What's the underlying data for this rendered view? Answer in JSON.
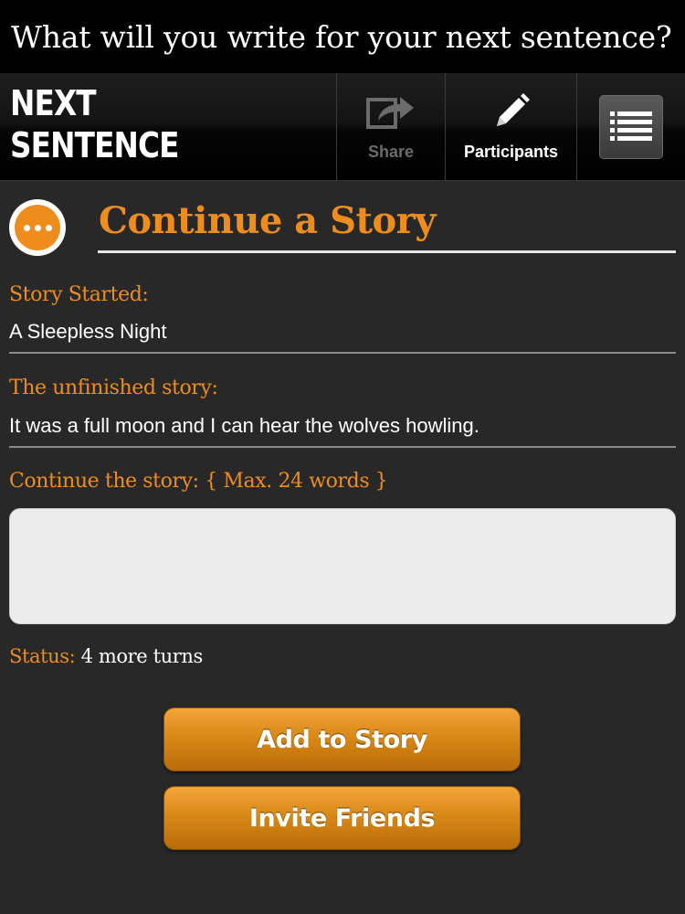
{
  "banner": {
    "title": "What will you write for your next sentence?"
  },
  "app": {
    "logo_line1": "NEXT",
    "logo_line2": "SENTENCE"
  },
  "toolbar": {
    "share": {
      "label": "Share",
      "icon": "share-icon"
    },
    "participants": {
      "label": "Participants",
      "icon": "pencil-icon"
    },
    "menu": {
      "icon": "list-menu-icon"
    }
  },
  "page": {
    "heading": "Continue a Story",
    "icon": "more-dots-icon"
  },
  "story_started": {
    "label": "Story Started:",
    "value": "A Sleepless Night"
  },
  "unfinished": {
    "label": "The unfinished story:",
    "value": "It was a full moon and I can hear the wolves howling."
  },
  "continue": {
    "label": "Continue the story: { Max. 24 words }",
    "value": ""
  },
  "status": {
    "label": "Status:",
    "value": "4 more turns"
  },
  "buttons": {
    "add": "Add to Story",
    "invite": "Invite Friends"
  },
  "colors": {
    "accent": "#ef8d1c",
    "background": "#282828",
    "header": "#000000"
  }
}
